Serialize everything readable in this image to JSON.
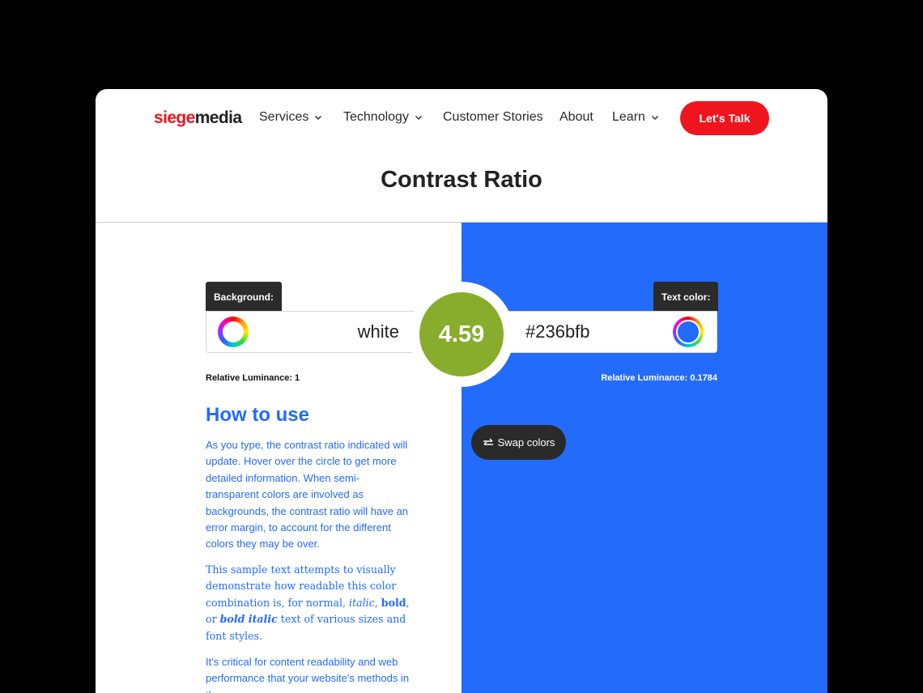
{
  "header": {
    "logo_part1": "siege",
    "logo_part2": "media",
    "nav": {
      "services": "Services",
      "technology": "Technology",
      "customer_stories": "Customer Stories",
      "about": "About",
      "learn": "Learn"
    },
    "cta_label": "Let's Talk"
  },
  "page_title": "Contrast Ratio",
  "background": {
    "tag_label": "Background:",
    "value": "white",
    "luminance_label": "Relative Luminance: 1"
  },
  "text_color": {
    "tag_label": "Text color:",
    "value": "#236bfb",
    "luminance_label": "Relative Luminance: 0.1784"
  },
  "ratio": "4.59",
  "swap_label": "Swap colors",
  "how_to": {
    "title": "How to use",
    "p1": "As you type, the contrast ratio indicated will update. Hover over the circle to get more detailed information. When semi-transparent colors are involved as backgrounds, the contrast ratio will have an error margin, to account for the different colors they may be over.",
    "p2_a": "This sample text attempts to visually demonstrate how readable this color combination is, for normal, ",
    "p2_italic": "italic",
    "p2_b": ", ",
    "p2_bold": "bold",
    "p2_c": ", or ",
    "p2_bold_italic": "bold italic",
    "p2_d": " text of various sizes and font styles.",
    "p3": "It's critical for content readability and web performance that your website's methods in the"
  },
  "colors": {
    "brand_red": "#f0141e",
    "accent_blue": "#236bfb",
    "ratio_green": "#88ad2c",
    "dark": "#2b2b2b"
  },
  "icons": {
    "chevron": "chevron-down-icon",
    "color_wheel": "color-wheel-icon",
    "swap": "swap-arrows-icon"
  }
}
